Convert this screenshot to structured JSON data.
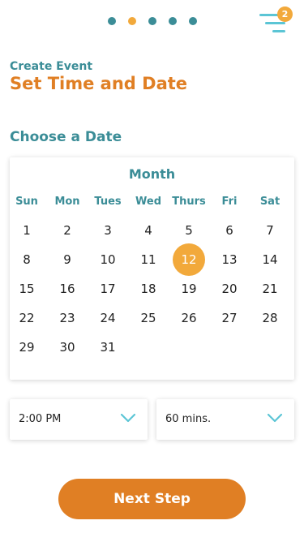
{
  "progress": {
    "steps": 5,
    "active_index": 1
  },
  "menu": {
    "badge_count": "2",
    "icon": "menu-icon"
  },
  "header": {
    "eyebrow": "Create Event",
    "title": "Set Time and Date"
  },
  "date_section": {
    "title": "Choose a Date"
  },
  "calendar": {
    "month_label": "Month",
    "weekdays": [
      "Sun",
      "Mon",
      "Tues",
      "Wed",
      "Thurs",
      "Fri",
      "Sat"
    ],
    "days": [
      "1",
      "2",
      "3",
      "4",
      "5",
      "6",
      "7",
      "8",
      "9",
      "10",
      "11",
      "12",
      "13",
      "14",
      "15",
      "16",
      "17",
      "18",
      "19",
      "20",
      "21",
      "22",
      "23",
      "24",
      "25",
      "26",
      "27",
      "28",
      "29",
      "30",
      "31"
    ],
    "selected_day": "12"
  },
  "time_select": {
    "value": "2:00 PM",
    "icon": "chevron-down-icon"
  },
  "duration_select": {
    "value": "60 mins.",
    "icon": "chevron-down-icon"
  },
  "next_button": {
    "label": "Next Step"
  },
  "colors": {
    "teal": "#3b8d97",
    "orange": "#e07f24",
    "amber": "#f2a93b",
    "light_teal": "#5bc5d5"
  }
}
